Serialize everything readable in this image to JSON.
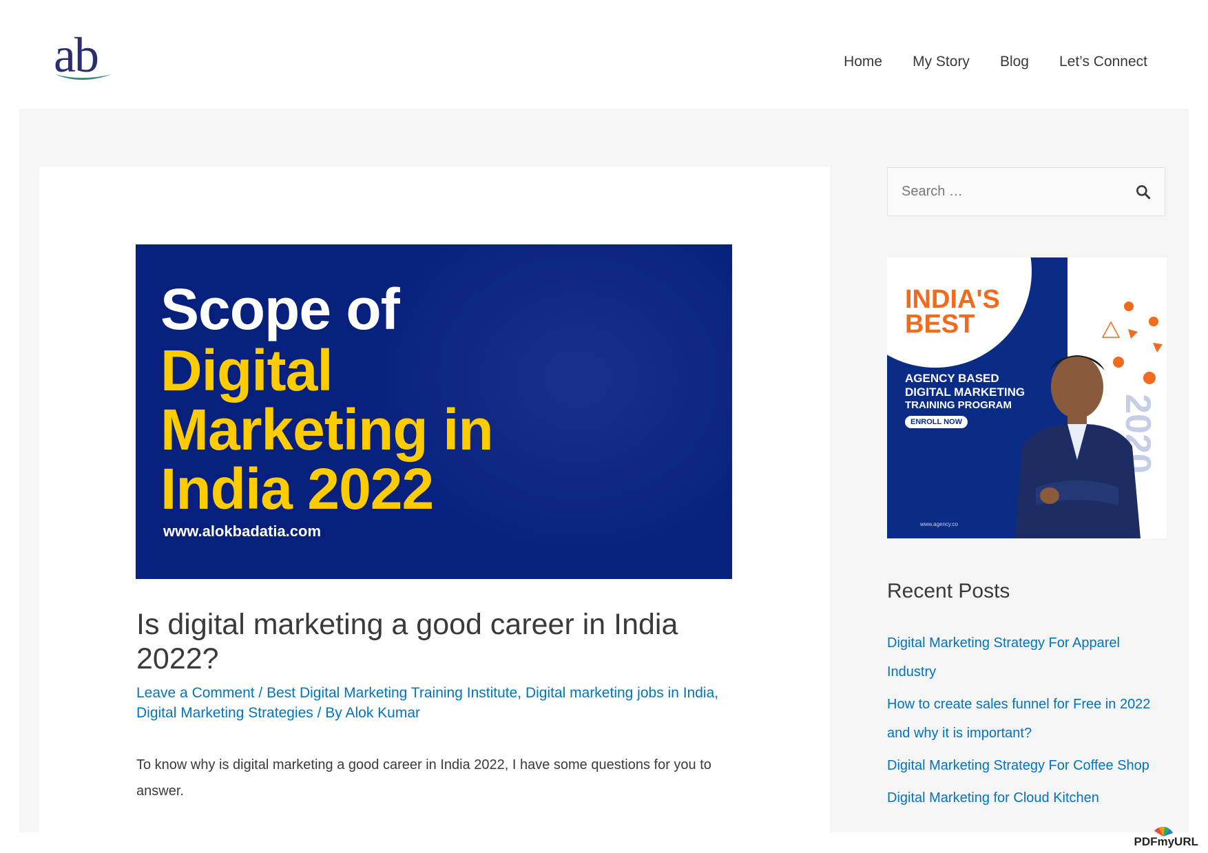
{
  "header": {
    "logo_text": "ab",
    "nav": [
      "Home",
      "My Story",
      "Blog",
      "Let’s Connect"
    ]
  },
  "featured_image": {
    "line1": "Scope of",
    "line2": "Digital",
    "line3": "Marketing in",
    "line4": "India 2022",
    "url": "www.alokbadatia.com",
    "colors": {
      "background": "#07207d",
      "highlight": "#ffcc00"
    }
  },
  "post": {
    "title": "Is digital marketing a good career in India 2022?",
    "meta": {
      "comment_link": "Leave a Comment",
      "sep1": " / ",
      "cat1": "Best Digital Marketing Training Institute",
      "comma1": ", ",
      "cat2": "Digital marketing jobs in India",
      "comma2": ", ",
      "cat3": "Digital Marketing Strategies",
      "by": " / By ",
      "author": "Alok Kumar"
    },
    "intro": "To know why is digital marketing a good career in India 2022, I have some questions for you to answer."
  },
  "sidebar": {
    "search_placeholder": "Search …",
    "promo": {
      "best_line1": "INDIA'S",
      "best_line2": "BEST",
      "agency_line1": "AGENCY BASED",
      "agency_line2": "DIGITAL MARKETING",
      "agency_line3": "TRAINING PROGRAM",
      "cta": "ENROLL NOW",
      "site": "www.agency.co",
      "year": "2020"
    },
    "recent_posts_title": "Recent Posts",
    "recent_posts": [
      "Digital Marketing Strategy For Apparel Industry",
      "How to create sales funnel for Free in 2022 and why it is important?",
      "Digital Marketing Strategy For Coffee Shop",
      "Digital Marketing for Cloud Kitchen"
    ]
  },
  "footer_badge": "PDFmyURL",
  "colors": {
    "link": "#0274be",
    "text": "#3a3a3a",
    "page_bg": "#f5f5f5",
    "promo_blue": "#0b2c86",
    "promo_orange": "#f26a1b"
  }
}
